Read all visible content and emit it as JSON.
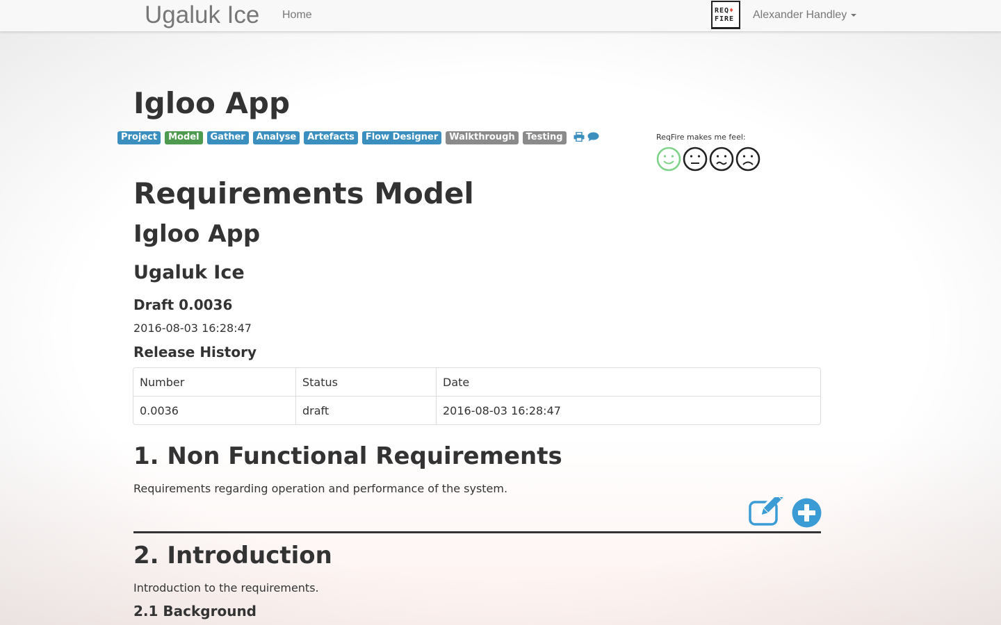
{
  "navbar": {
    "brand": "Ugaluk Ice",
    "home_label": "Home",
    "logo_text_line1": "REQ",
    "logo_text_line2": "FIRE",
    "user_name": "Alexander Handley"
  },
  "project": {
    "title": "Igloo App",
    "nav_labels": [
      {
        "label": "Project",
        "color": "#3a8fbf"
      },
      {
        "label": "Model",
        "color": "#4e9a4e"
      },
      {
        "label": "Gather",
        "color": "#3a8fbf"
      },
      {
        "label": "Analyse",
        "color": "#3a8fbf"
      },
      {
        "label": "Artefacts",
        "color": "#3a8fbf"
      },
      {
        "label": "Flow Designer",
        "color": "#3a8fbf"
      },
      {
        "label": "Walkthrough",
        "color": "#8a8a8a"
      },
      {
        "label": "Testing",
        "color": "#8a8a8a"
      }
    ],
    "icons": [
      "print-icon",
      "comment-icon"
    ]
  },
  "feedback": {
    "prompt": "ReqFire makes me feel:",
    "faces": [
      "happy-face-icon",
      "neutral-face-icon",
      "worried-face-icon",
      "sad-face-icon"
    ],
    "selected_color": "#7fd28a"
  },
  "document": {
    "heading": "Requirements Model",
    "app_name": "Igloo App",
    "organization": "Ugaluk Ice",
    "draft": "Draft 0.0036",
    "timestamp": "2016-08-03 16:28:47",
    "release_history_title": "Release History",
    "release_history": {
      "headers": [
        "Number",
        "Status",
        "Date"
      ],
      "rows": [
        [
          "0.0036",
          "draft",
          "2016-08-03 16:28:47"
        ]
      ]
    },
    "sections": [
      {
        "title": "1. Non Functional Requirements",
        "description": "Requirements regarding operation and performance of the system."
      },
      {
        "title": "2. Introduction",
        "description": "Introduction to the requirements.",
        "subsection": "2.1 Background"
      }
    ]
  },
  "accent": "#3a9bd5"
}
